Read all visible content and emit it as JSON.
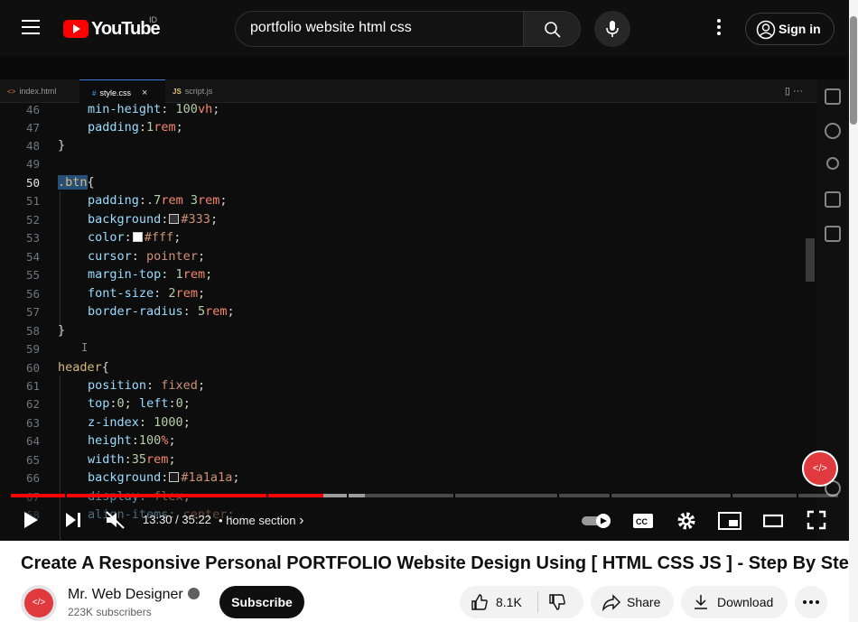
{
  "header": {
    "logo_text": "YouTube",
    "region": "ID",
    "search_value": "portfolio website html css",
    "signin_label": "Sign in"
  },
  "editor": {
    "tabs": [
      {
        "icon": "<>",
        "label": "index.html"
      },
      {
        "icon": "#",
        "label": "style.css"
      },
      {
        "icon": "JS",
        "label": "script.js"
      }
    ],
    "actions": "▯  ···",
    "line_numbers": [
      "46",
      "47",
      "48",
      "49",
      "50",
      "51",
      "52",
      "53",
      "54",
      "55",
      "56",
      "57",
      "58",
      "59",
      "60",
      "61",
      "62",
      "63",
      "64",
      "65",
      "66",
      "67",
      "68"
    ],
    "lines": {
      "l46": [
        "min-height",
        ": ",
        "100",
        "vh",
        ";"
      ],
      "l47": [
        "padding",
        ":",
        "1",
        "rem",
        ";"
      ],
      "l48": "}",
      "l50_sel": ".btn",
      "l50_brace": "{",
      "l51": [
        "padding",
        ":",
        ".7",
        "rem",
        " ",
        "3",
        "rem",
        ";"
      ],
      "l52": [
        "background",
        ":",
        "#333",
        ";"
      ],
      "l53": [
        "color",
        ":",
        "#fff",
        ";"
      ],
      "l54": [
        "cursor",
        ": ",
        "pointer",
        ";"
      ],
      "l55": [
        "margin-top",
        ": ",
        "1",
        "rem",
        ";"
      ],
      "l56": [
        "font-size",
        ": ",
        "2",
        "rem",
        ";"
      ],
      "l57": [
        "border-radius",
        ": ",
        "5",
        "rem",
        ";"
      ],
      "l58": "}",
      "l59_cursor": "I",
      "l60_sel": "header",
      "l60_brace": "{",
      "l61": [
        "position",
        ": ",
        "fixed",
        ";"
      ],
      "l62": [
        "top",
        ":",
        "0",
        "; ",
        "left",
        ":",
        "0",
        ";"
      ],
      "l63": [
        "z-index",
        ": ",
        "1000",
        ";"
      ],
      "l64": [
        "height",
        ":",
        "100",
        "%",
        ";"
      ],
      "l65": [
        "width",
        ":",
        "35",
        "rem",
        ";"
      ],
      "l66": [
        "background",
        ":",
        "#1a1a1a",
        ";"
      ],
      "l67": [
        "display",
        ": ",
        "flex",
        ";"
      ],
      "l68": [
        "align-items",
        ": ",
        "center",
        ";"
      ]
    },
    "colors": {
      "swatch_333": "#333333",
      "swatch_fff": "#ffffff",
      "swatch_1a1a1a": "#1a1a1a"
    },
    "fab_label": "</>"
  },
  "player": {
    "progress_fraction": 0.3774,
    "time_display": "13:30 / 35:22",
    "separator": "•",
    "chapter_label": "home section",
    "chapter_chevron": "›"
  },
  "video": {
    "title": "Create A Responsive Personal PORTFOLIO Website Design Using [ HTML CSS JS ] - Step By Step",
    "channel_name": "Mr. Web Designer",
    "subscribers": "223K subscribers",
    "subscribe_label": "Subscribe",
    "likes": "8.1K",
    "share_label": "Share",
    "download_label": "Download",
    "avatar_label": "</>"
  },
  "colors": {
    "brand_red": "#ff0000",
    "played": "#ff0000",
    "channel_accent": "#e0393e"
  }
}
